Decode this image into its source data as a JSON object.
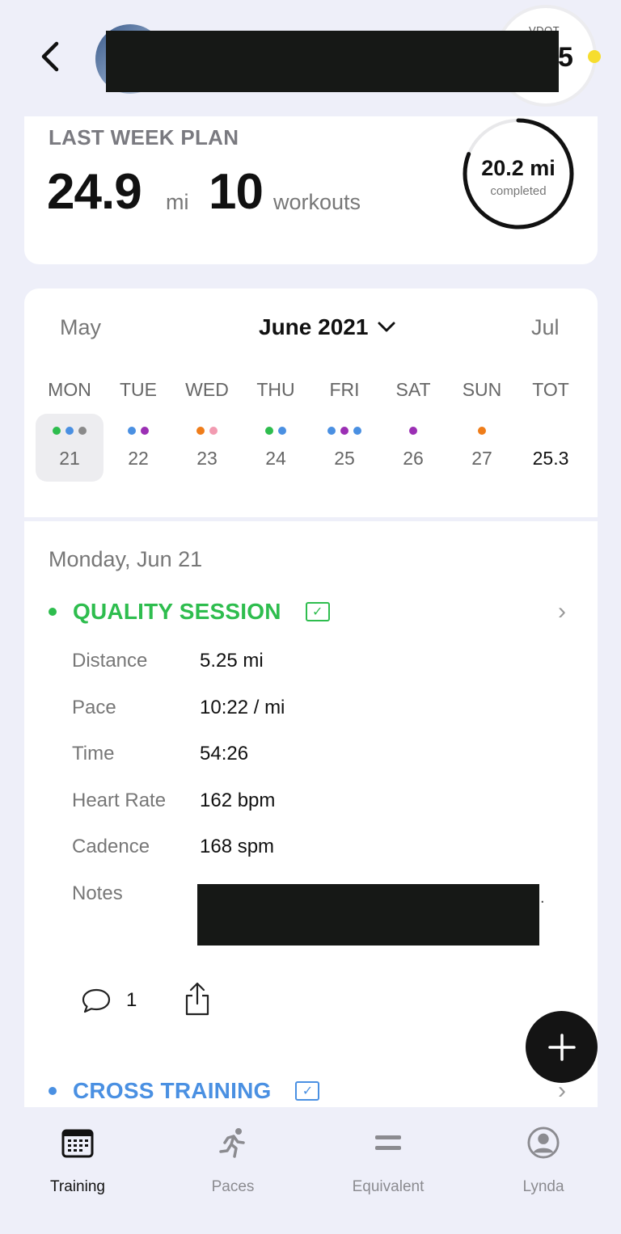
{
  "header": {
    "vdot_label": "VDOT",
    "vdot_value": "5",
    "vdot_dot_color": "#f6dd2e"
  },
  "plan": {
    "title": "LAST WEEK PLAN",
    "miles": "24.9",
    "miles_unit": "mi",
    "workouts": "10",
    "workouts_unit": "workouts",
    "completed_value": "20.2 mi",
    "completed_label": "completed",
    "completed_fraction": 0.81
  },
  "calendar": {
    "prev_month": "May",
    "current_month": "June 2021",
    "next_month": "Jul",
    "weekdays": [
      "MON",
      "TUE",
      "WED",
      "THU",
      "FRI",
      "SAT",
      "SUN",
      "TOT"
    ],
    "days": [
      {
        "num": "21",
        "dots": [
          "#2ebd4e",
          "#4a90e2",
          "#8a8a8a"
        ],
        "selected": true
      },
      {
        "num": "22",
        "dots": [
          "#4a90e2",
          "#9b2fb4"
        ]
      },
      {
        "num": "23",
        "dots": [
          "#ef7d1a",
          "#f29bb1"
        ]
      },
      {
        "num": "24",
        "dots": [
          "#2ebd4e",
          "#4a90e2"
        ]
      },
      {
        "num": "25",
        "dots": [
          "#4a90e2",
          "#9b2fb4",
          "#4a90e2"
        ]
      },
      {
        "num": "26",
        "dots": [
          "#9b2fb4"
        ]
      },
      {
        "num": "27",
        "dots": [
          "#ef7d1a"
        ]
      }
    ],
    "total": "25.3"
  },
  "workout": {
    "date": "Monday, Jun 21",
    "sessions": [
      {
        "title": "QUALITY SESSION",
        "color": "#2ebd4e",
        "checked": "✓"
      },
      {
        "title": "CROSS TRAINING",
        "color": "#4a90e2",
        "checked": "✓"
      }
    ],
    "stats": [
      {
        "label": "Distance",
        "value": "5.25 mi"
      },
      {
        "label": "Pace",
        "value": "10:22 / mi"
      },
      {
        "label": "Time",
        "value": "54:26"
      },
      {
        "label": "Heart Rate",
        "value": "162 bpm"
      },
      {
        "label": "Cadence",
        "value": "168 spm"
      },
      {
        "label": "Notes",
        "value": ""
      }
    ],
    "notes_trailing": ".",
    "comment_count": "1"
  },
  "tabs": [
    {
      "label": "Training",
      "icon": "calendar-icon",
      "active": true
    },
    {
      "label": "Paces",
      "icon": "runner-icon"
    },
    {
      "label": "Equivalent",
      "icon": "equals-icon"
    },
    {
      "label": "Lynda",
      "icon": "profile-icon"
    }
  ]
}
